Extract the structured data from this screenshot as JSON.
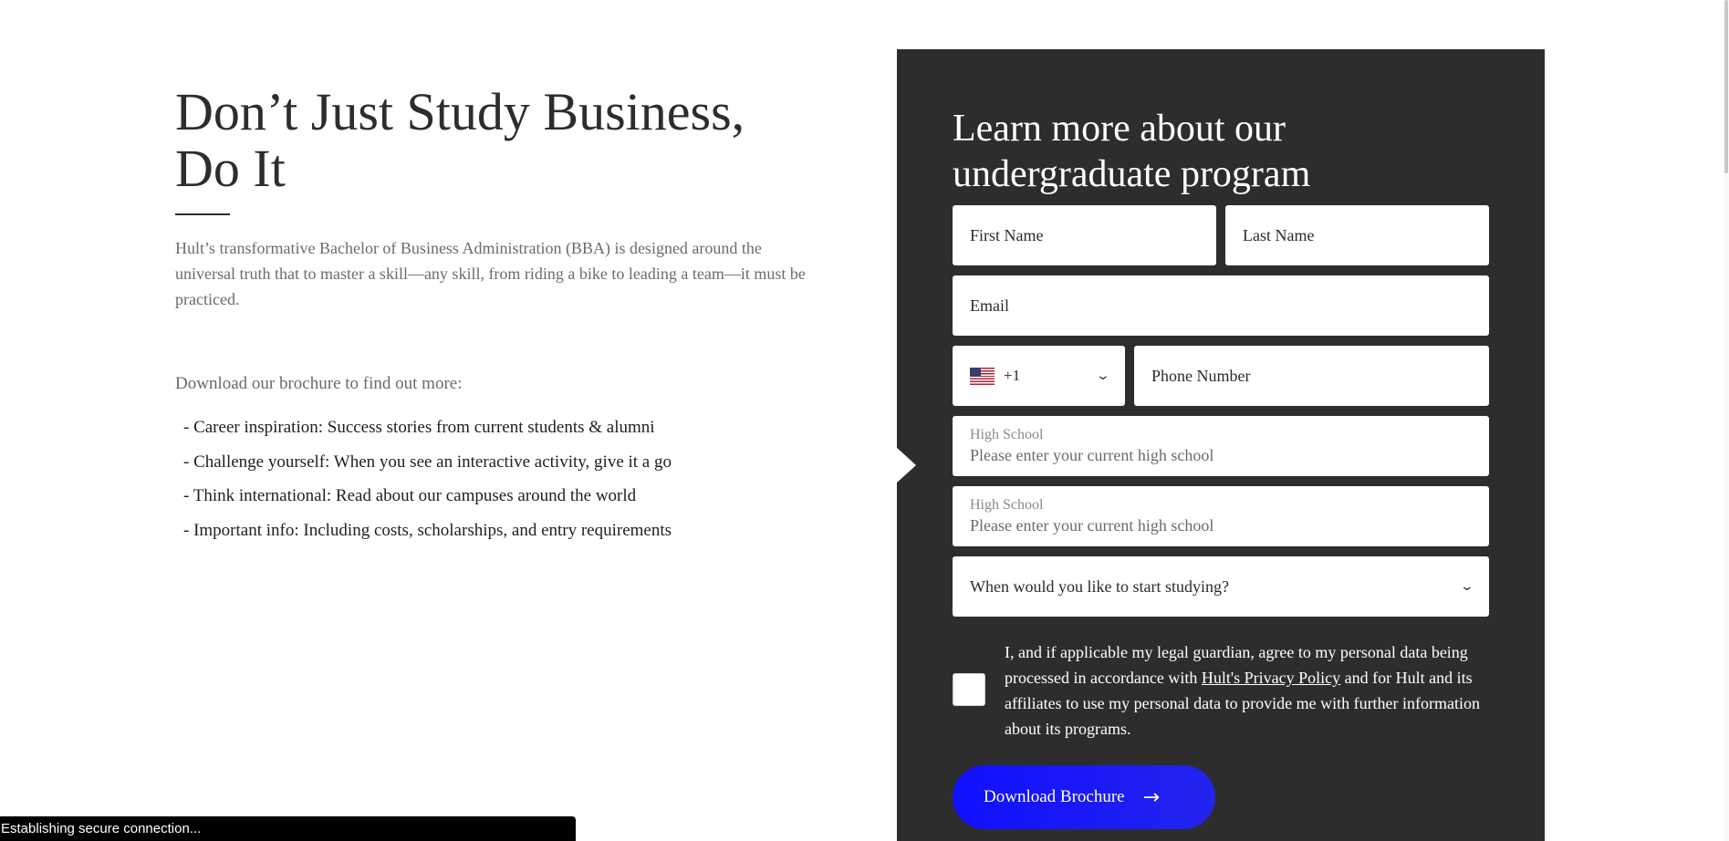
{
  "hero": {
    "headline_line1": "Don’t Just Study Business,",
    "headline_line2": "Do It",
    "intro": "Hult’s transformative Bachelor of Business Administration (BBA) is designed around the universal truth that to master a skill—any skill, from riding a bike to leading a team—it must be practiced.",
    "cta_text": "Download our brochure to find out more:",
    "bullets": [
      "- Career inspiration: Success stories from current students & alumni",
      "- Challenge yourself: When you see an interactive activity, give it a go",
      "- Think international: Read about our campuses around the world",
      "- Important info: Including costs, scholarships, and entry requirements"
    ]
  },
  "form": {
    "title": "Learn more about our undergraduate program",
    "first_name_placeholder": "First Name",
    "last_name_placeholder": "Last Name",
    "email_placeholder": "Email",
    "country_code": "+1",
    "country_flag_icon": "us-flag-icon",
    "phone_placeholder": "Phone Number",
    "high_school_label": "High School",
    "high_school_placeholder": "Please enter your current high school",
    "high_school_label_2": "High School",
    "high_school_placeholder_2": "Please enter your current high school",
    "start_select": "When would you like to start studying?",
    "consent_before": "I, and if applicable my legal guardian, agree to my personal data being processed in accordance with ",
    "consent_link": "Hult's Privacy Policy",
    "consent_after": " and for Hult and its affiliates to use my personal data to provide me with further information about its programs.",
    "download_button": "Download Brochure",
    "download_icon": "arrow-right-icon"
  },
  "status_bar": {
    "text": "Establishing secure connection..."
  },
  "colors": {
    "panel_bg": "#2d2d2d",
    "button_blue": "#1010ff"
  }
}
